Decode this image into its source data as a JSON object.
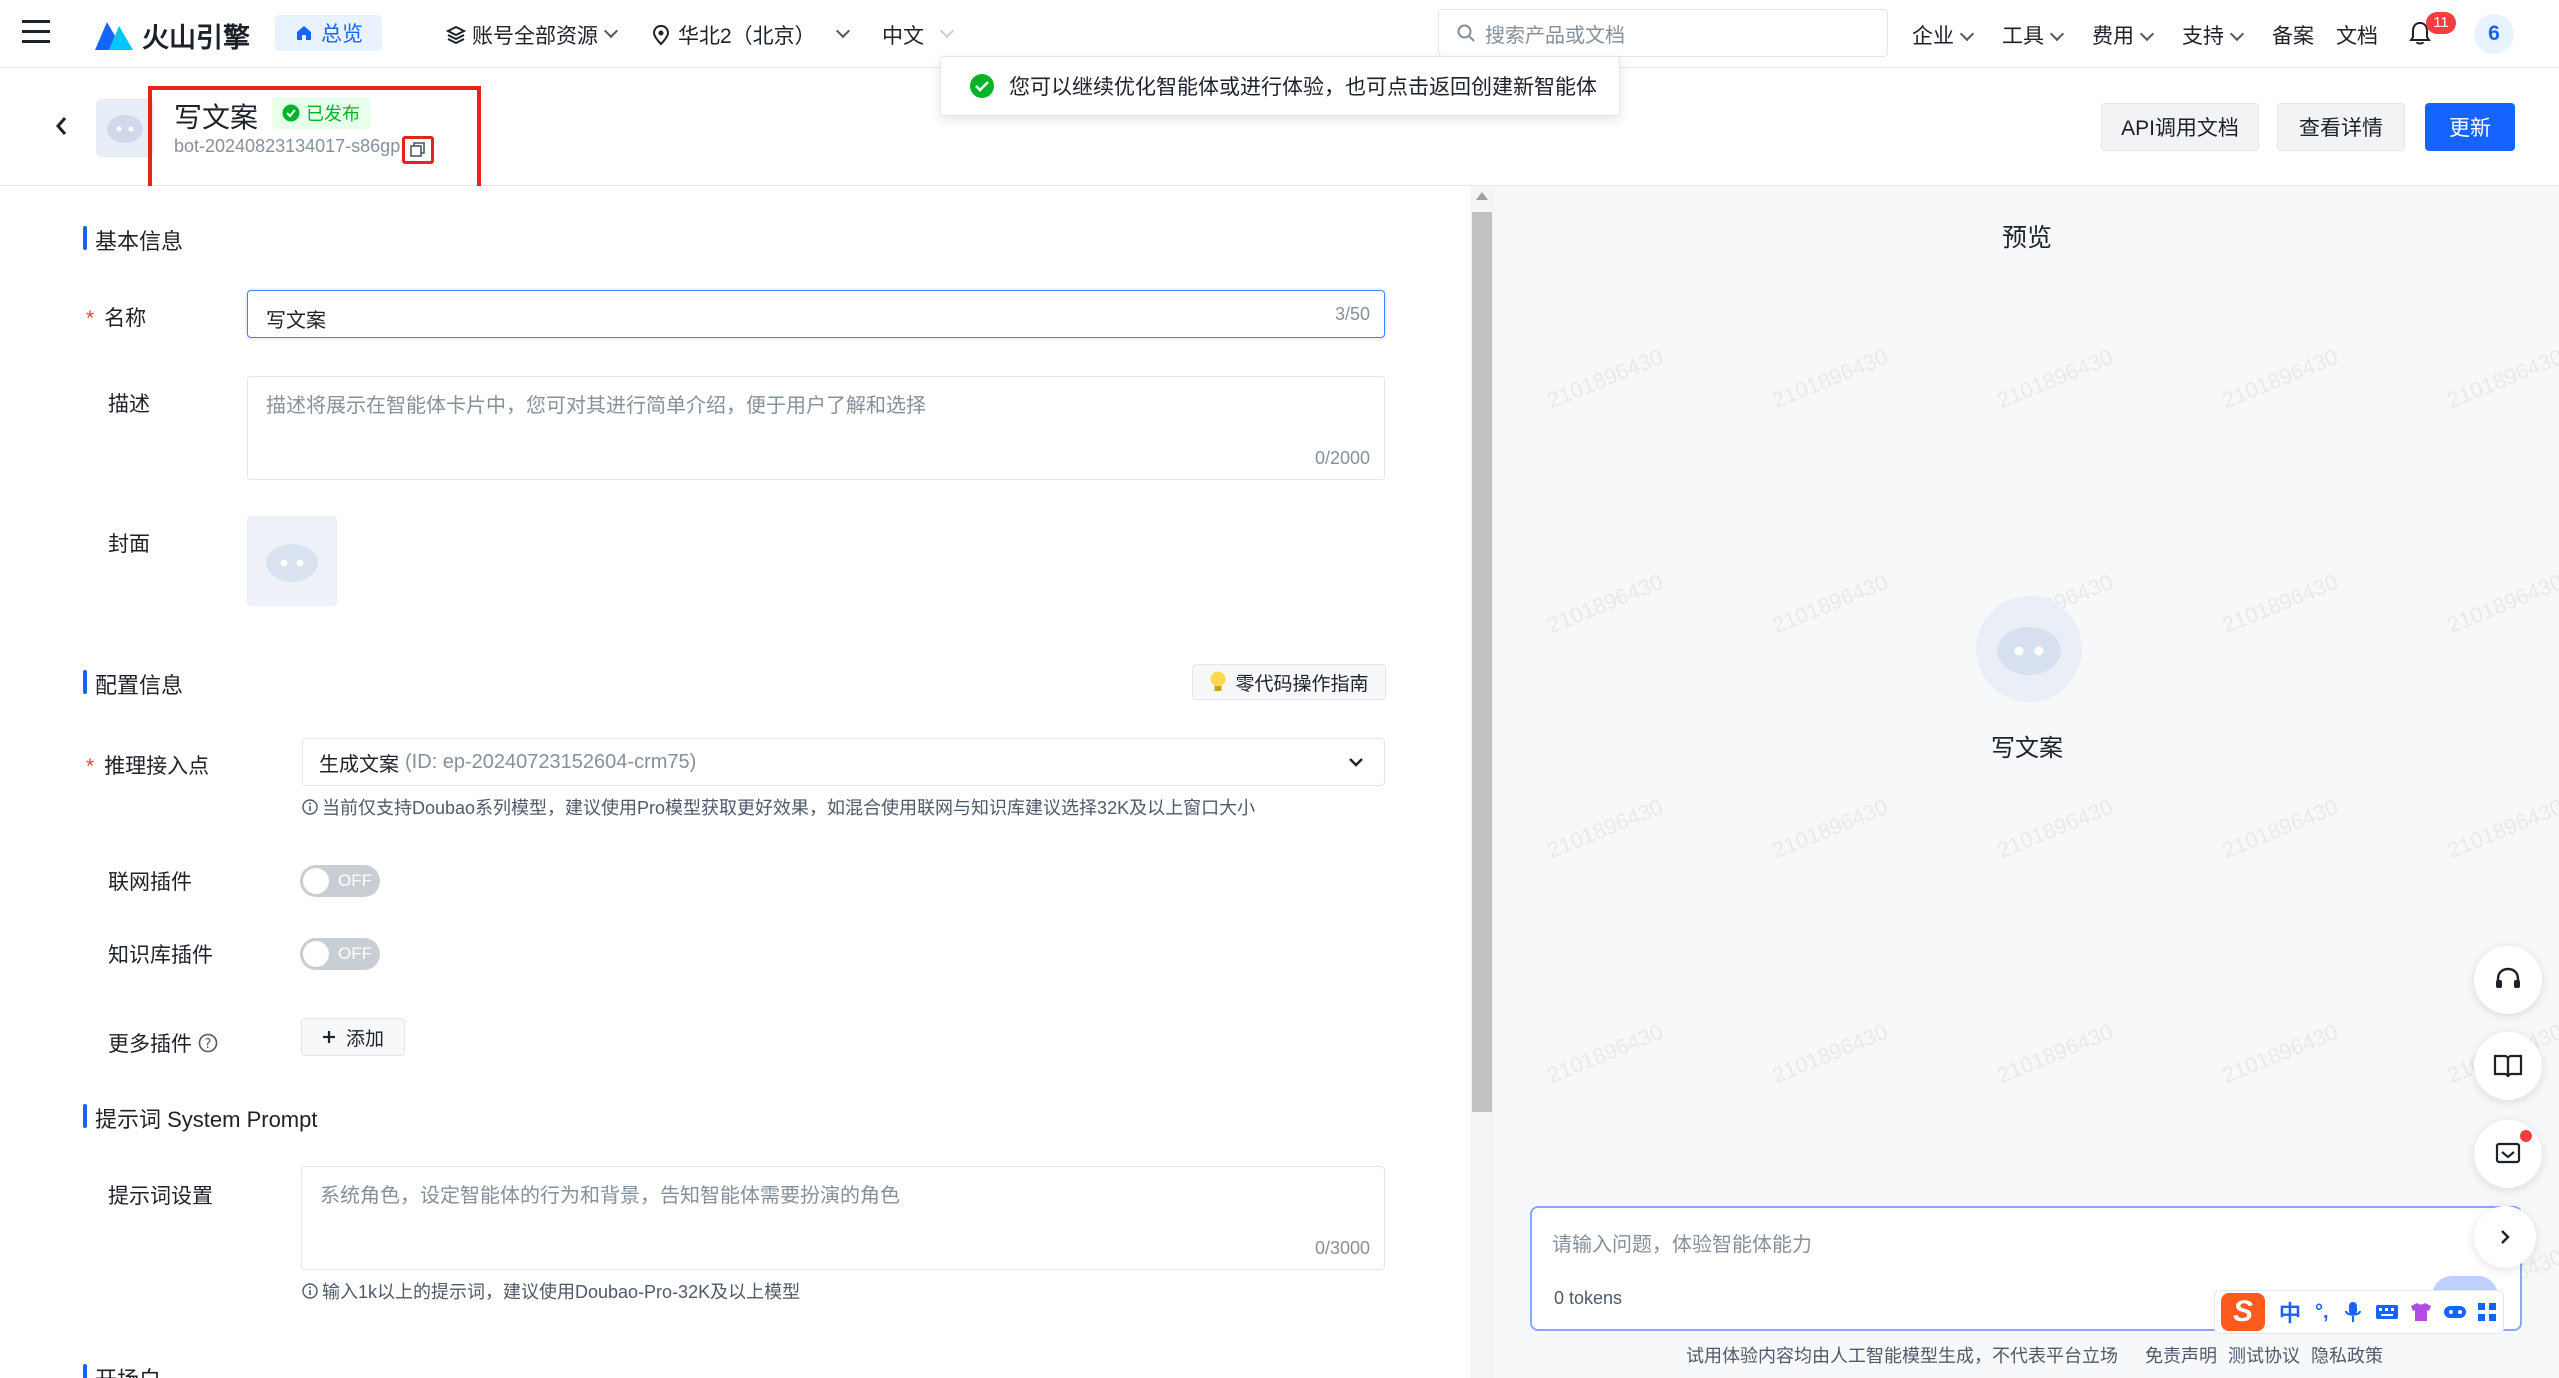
{
  "nav": {
    "brand": "火山引擎",
    "overview": "总览",
    "resources": "账号全部资源",
    "region": "华北2（北京）",
    "language": "中文",
    "search_placeholder": "搜索产品或文档",
    "menu": [
      "企业",
      "工具",
      "费用",
      "支持"
    ],
    "links": [
      "备案",
      "文档"
    ],
    "notification_count": "11",
    "avatar_text": "6"
  },
  "toast": {
    "message": "您可以继续优化智能体或进行体验，也可点击返回创建新智能体"
  },
  "header": {
    "title": "写文案",
    "status": "已发布",
    "bot_id": "bot-20240823134017-s86gp",
    "buttons": {
      "api_docs": "API调用文档",
      "details": "查看详情",
      "update": "更新"
    }
  },
  "form": {
    "basic_section": "基本信息",
    "name_label": "名称",
    "name_value": "写文案",
    "name_count": "3/50",
    "desc_label": "描述",
    "desc_placeholder": "描述将展示在智能体卡片中，您可对其进行简单介绍，便于用户了解和选择",
    "desc_count": "0/2000",
    "cover_label": "封面",
    "config_section": "配置信息",
    "guide_button": "零代码操作指南",
    "endpoint_label": "推理接入点",
    "endpoint_value": "生成文案",
    "endpoint_id": "(ID: ep-20240723152604-crm75)",
    "endpoint_hint": "当前仅支持Doubao系列模型，建议使用Pro模型获取更好效果，如混合使用联网与知识库建议选择32K及以上窗口大小",
    "web_plugin_label": "联网插件",
    "kb_plugin_label": "知识库插件",
    "toggle_off": "OFF",
    "more_plugins_label": "更多插件",
    "add_button": "添加",
    "prompt_section": "提示词 System Prompt",
    "prompt_label": "提示词设置",
    "prompt_placeholder": "系统角色，设定智能体的行为和背景，告知智能体需要扮演的角色",
    "prompt_count": "0/3000",
    "prompt_hint": "输入1k以上的提示词，建议使用Doubao-Pro-32K及以上模型",
    "next_section": "开场白"
  },
  "preview": {
    "title": "预览",
    "bot_name": "写文案",
    "input_placeholder": "请输入问题，体验智能体能力",
    "tokens": "0 tokens",
    "watermark": "2101896430",
    "footer_disclaimer": "试用体验内容均由人工智能模型生成，不代表平台立场",
    "footer_links": [
      "免责声明",
      "测试协议",
      "隐私政策"
    ]
  },
  "ime": {
    "lang": "中",
    "punct": "°,"
  },
  "colors": {
    "accent": "#1664ff",
    "success": "#00b42a",
    "danger": "#f53f3f",
    "annotation": "#e8221b"
  }
}
